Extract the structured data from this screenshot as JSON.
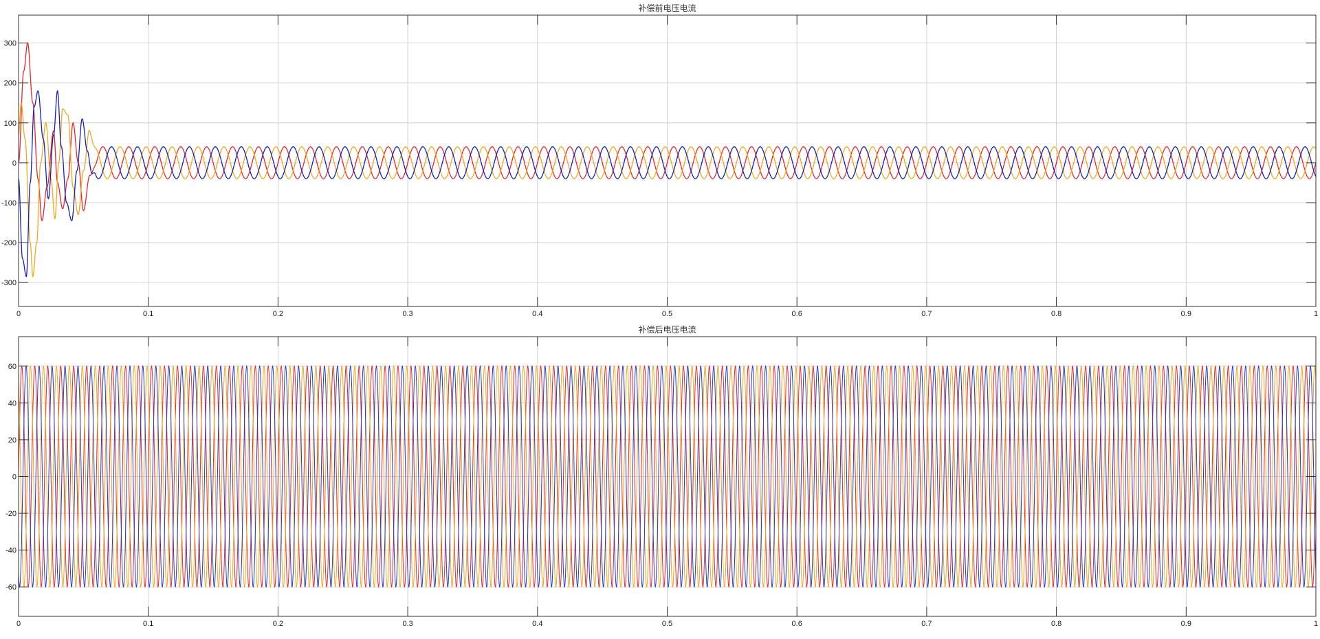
{
  "chart_data": [
    {
      "type": "line",
      "title": "补偿前电压电流",
      "xlabel": "",
      "ylabel": "",
      "xlim": [
        0,
        1
      ],
      "ylim": [
        -360,
        370
      ],
      "x_ticks": [
        0,
        0.1,
        0.2,
        0.3,
        0.4,
        0.5,
        0.6,
        0.7,
        0.8,
        0.9,
        1
      ],
      "x_tick_labels": [
        "0",
        "0.1",
        "0.2",
        "0.3",
        "0.4",
        "0.5",
        "0.6",
        "0.7",
        "0.8",
        "0.9",
        "1"
      ],
      "y_ticks": [
        -300,
        -200,
        -100,
        0,
        100,
        200,
        300
      ],
      "y_tick_labels": [
        "-300",
        "-200",
        "-100",
        "0",
        "100",
        "200",
        "300"
      ],
      "grid": true,
      "legend": "none",
      "frequency_hz": 50,
      "steady_amplitude": 40,
      "transient_end_s": 0.06,
      "series": [
        {
          "color": "#e8262e",
          "phase_deg": 0,
          "transient_points": [
            [
              0,
              0
            ],
            [
              0.004,
              230
            ],
            [
              0.007,
              300
            ],
            [
              0.011,
              150
            ],
            [
              0.015,
              -40
            ],
            [
              0.018,
              -145
            ],
            [
              0.022,
              -60
            ],
            [
              0.027,
              80
            ],
            [
              0.03,
              -50
            ],
            [
              0.034,
              -115
            ],
            [
              0.038,
              -40
            ],
            [
              0.042,
              100
            ],
            [
              0.046,
              0
            ],
            [
              0.05,
              -120
            ],
            [
              0.055,
              -30
            ],
            [
              0.06,
              25
            ]
          ]
        },
        {
          "color": "#f0a81c",
          "phase_deg": 120,
          "transient_points": [
            [
              0,
              70
            ],
            [
              0.002,
              150
            ],
            [
              0.005,
              60
            ],
            [
              0.009,
              -200
            ],
            [
              0.011,
              -285
            ],
            [
              0.014,
              -200
            ],
            [
              0.017,
              0
            ],
            [
              0.021,
              100
            ],
            [
              0.025,
              -40
            ],
            [
              0.028,
              -140
            ],
            [
              0.031,
              0
            ],
            [
              0.034,
              135
            ],
            [
              0.038,
              120
            ],
            [
              0.042,
              -60
            ],
            [
              0.046,
              -130
            ],
            [
              0.05,
              -20
            ],
            [
              0.055,
              90
            ],
            [
              0.06,
              30
            ]
          ]
        },
        {
          "color": "#1420b8",
          "phase_deg": -120,
          "transient_points": [
            [
              0,
              -40
            ],
            [
              0.003,
              -240
            ],
            [
              0.006,
              -285
            ],
            [
              0.009,
              -50
            ],
            [
              0.012,
              140
            ],
            [
              0.015,
              180
            ],
            [
              0.019,
              60
            ],
            [
              0.023,
              -90
            ],
            [
              0.027,
              70
            ],
            [
              0.03,
              180
            ],
            [
              0.033,
              40
            ],
            [
              0.037,
              -100
            ],
            [
              0.041,
              -145
            ],
            [
              0.045,
              -20
            ],
            [
              0.049,
              110
            ],
            [
              0.053,
              30
            ],
            [
              0.057,
              -50
            ],
            [
              0.06,
              -20
            ]
          ]
        }
      ]
    },
    {
      "type": "line",
      "title": "补偿后电压电流",
      "xlabel": "",
      "ylabel": "",
      "xlim": [
        0,
        1
      ],
      "ylim": [
        -76,
        76
      ],
      "x_ticks": [
        0,
        0.1,
        0.2,
        0.3,
        0.4,
        0.5,
        0.6,
        0.7,
        0.8,
        0.9,
        1
      ],
      "x_tick_labels": [
        "0",
        "0.1",
        "0.2",
        "0.3",
        "0.4",
        "0.5",
        "0.6",
        "0.7",
        "0.8",
        "0.9",
        "1"
      ],
      "y_ticks": [
        -60,
        -40,
        -20,
        0,
        20,
        40,
        60
      ],
      "y_tick_labels": [
        "-60",
        "-40",
        "-20",
        "0",
        "20",
        "40",
        "60"
      ],
      "grid": true,
      "legend": "none",
      "frequency_hz": 100,
      "steady_amplitude": 60,
      "series": [
        {
          "color": "#e8262e",
          "phase_deg": 0
        },
        {
          "color": "#f0a81c",
          "phase_deg": 120
        },
        {
          "color": "#2438cc",
          "phase_deg": -120
        }
      ]
    }
  ]
}
